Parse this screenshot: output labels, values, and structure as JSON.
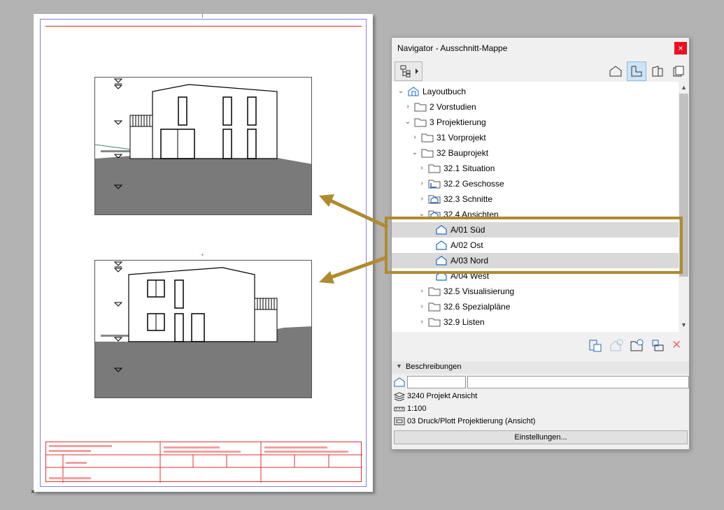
{
  "navigator": {
    "title": "Navigator - Ausschnitt-Mappe",
    "close_label": "×",
    "tree": [
      {
        "label": "Layoutbuch",
        "level": 0,
        "expanded": true,
        "icon": "layoutbook-icon"
      },
      {
        "label": "2 Vorstudien",
        "level": 1,
        "expanded": false,
        "icon": "folder-icon"
      },
      {
        "label": "3 Projektierung",
        "level": 1,
        "expanded": true,
        "icon": "folder-icon"
      },
      {
        "label": "31 Vorprojekt",
        "level": 2,
        "expanded": false,
        "icon": "folder-icon"
      },
      {
        "label": "32 Bauprojekt",
        "level": 2,
        "expanded": true,
        "icon": "folder-icon"
      },
      {
        "label": "32.1 Situation",
        "level": 3,
        "expanded": false,
        "icon": "folder-icon"
      },
      {
        "label": "32.2 Geschosse",
        "level": 3,
        "expanded": false,
        "icon": "floorplan-folder-icon"
      },
      {
        "label": "32.3 Schnitte",
        "level": 3,
        "expanded": false,
        "icon": "section-folder-icon"
      },
      {
        "label": "32.4 Ansichten",
        "level": 3,
        "expanded": true,
        "icon": "elevation-folder-icon"
      },
      {
        "label": "A/01 Süd",
        "level": 4,
        "selected": true,
        "icon": "elevation-icon"
      },
      {
        "label": "A/02 Ost",
        "level": 4,
        "selected": false,
        "icon": "elevation-icon"
      },
      {
        "label": "A/03 Nord",
        "level": 4,
        "selected": true,
        "icon": "elevation-icon"
      },
      {
        "label": "A/04 West",
        "level": 4,
        "selected": false,
        "icon": "elevation-icon"
      },
      {
        "label": "32.5 Visualisierung",
        "level": 3,
        "expanded": false,
        "icon": "folder-icon"
      },
      {
        "label": "32.6 Spezialpläne",
        "level": 3,
        "expanded": false,
        "icon": "folder-icon"
      },
      {
        "label": "32.9 Listen",
        "level": 3,
        "expanded": false,
        "icon": "folder-icon"
      }
    ],
    "description": {
      "header": "Beschreibungen",
      "id_value": "",
      "name_value": "",
      "layer_combination": "3240 Projekt Ansicht",
      "scale": "1:100",
      "pen_set": "03 Druck/Plott Projektierung (Ansicht)",
      "settings_button": "Einstellungen..."
    }
  },
  "colors": {
    "highlight": "#b08a2e",
    "accent_blue": "#1a6bc4",
    "title_block_red": "#e03030"
  }
}
